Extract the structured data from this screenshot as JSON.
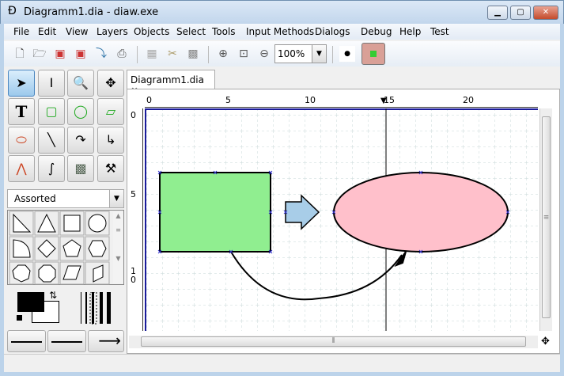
{
  "window": {
    "title": "Diagramm1.dia - diaw.exe",
    "minimize": "▁",
    "maximize": "▢",
    "close": "✕"
  },
  "menu": [
    {
      "label": "File"
    },
    {
      "label": "Edit"
    },
    {
      "label": "View"
    },
    {
      "label": "Layers"
    },
    {
      "label": "Objects"
    },
    {
      "label": "Select"
    },
    {
      "label": "Tools"
    },
    {
      "label": "Input Methods"
    },
    {
      "label": "Dialogs"
    },
    {
      "label": "Debug"
    },
    {
      "label": "Help"
    },
    {
      "label": "Test"
    }
  ],
  "toolbar": {
    "zoom": "100%",
    "buttons": [
      "new-icon",
      "open-icon",
      "save-icon",
      "save-as-icon",
      "export-icon",
      "print-icon",
      "copy-icon",
      "cut-icon",
      "paste-icon",
      "zoom-in-icon",
      "zoom-fit-icon",
      "zoom-out-icon"
    ]
  },
  "tools": [
    "pointer",
    "text-edit",
    "magnify",
    "scroll",
    "text",
    "box",
    "ellipse",
    "polygon",
    "beziergon",
    "line",
    "arc",
    "zigzag",
    "polyline",
    "bezier",
    "image",
    "outline"
  ],
  "sheet": {
    "selected": "Assorted"
  },
  "tab": {
    "label": "Diagramm1.dia",
    "close": "✖"
  },
  "ruler": {
    "h": [
      "0",
      "5",
      "10",
      "15",
      "20"
    ],
    "v": [
      "0",
      "5",
      "1\n0"
    ]
  },
  "colors": {
    "foreground": "#000000",
    "background": "#ffffff",
    "rect_fill": "#90ee90",
    "ellipse_fill": "#ffc0cb",
    "arrow_fill": "#a8cde8",
    "accent": "#1a1a9a"
  }
}
